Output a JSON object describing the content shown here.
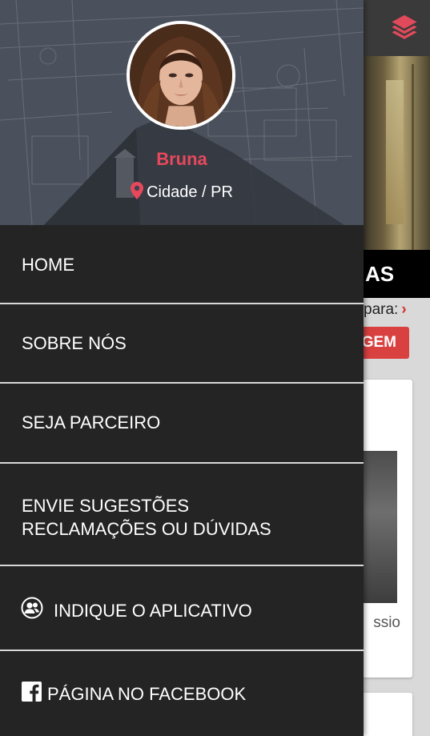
{
  "profile": {
    "name": "Bruna",
    "location": "Cidade / PR"
  },
  "menu": {
    "home": "HOME",
    "sobre": "SOBRE NÓS",
    "seja": "SEJA PARCEIRO",
    "envie_line1": "ENVIE SUGESTÕES",
    "envie_line2": "RECLAMAÇÕES OU DÚVIDAS",
    "indique": "INDIQUE O APLICATIVO",
    "facebook": "PÁGINA NO FACEBOOK"
  },
  "background": {
    "section_title_fragment": "AS",
    "filter_text_fragment": "para:",
    "button_fragment": "GEM",
    "card_text_fragment": "ssio"
  },
  "colors": {
    "accent": "#e8485c",
    "drawer_bg": "#242424",
    "divider": "#d8d8d8",
    "button_red": "#d94040"
  },
  "icons": {
    "topbar": "layers-icon",
    "location": "map-pin-icon",
    "indique": "users-icon",
    "facebook": "facebook-icon"
  }
}
